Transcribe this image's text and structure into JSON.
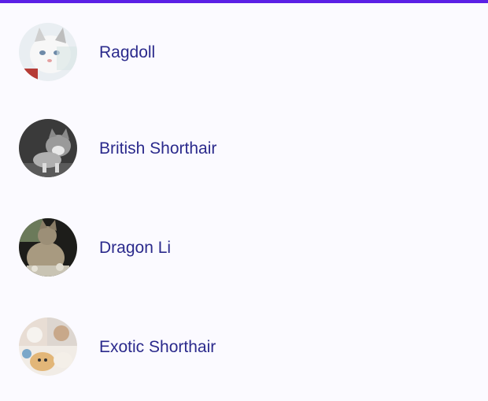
{
  "theme": {
    "accent": "#5b20e6",
    "background": "#fbfaff",
    "label_color": "#2b2a8c"
  },
  "cats": [
    {
      "name": "Ragdoll",
      "avatar_icon": "ragdoll-cat-photo-icon"
    },
    {
      "name": "British Shorthair",
      "avatar_icon": "british-shorthair-cat-photo-icon"
    },
    {
      "name": "Dragon Li",
      "avatar_icon": "dragon-li-cat-photo-icon"
    },
    {
      "name": "Exotic Shorthair",
      "avatar_icon": "exotic-shorthair-cat-photo-icon"
    }
  ]
}
